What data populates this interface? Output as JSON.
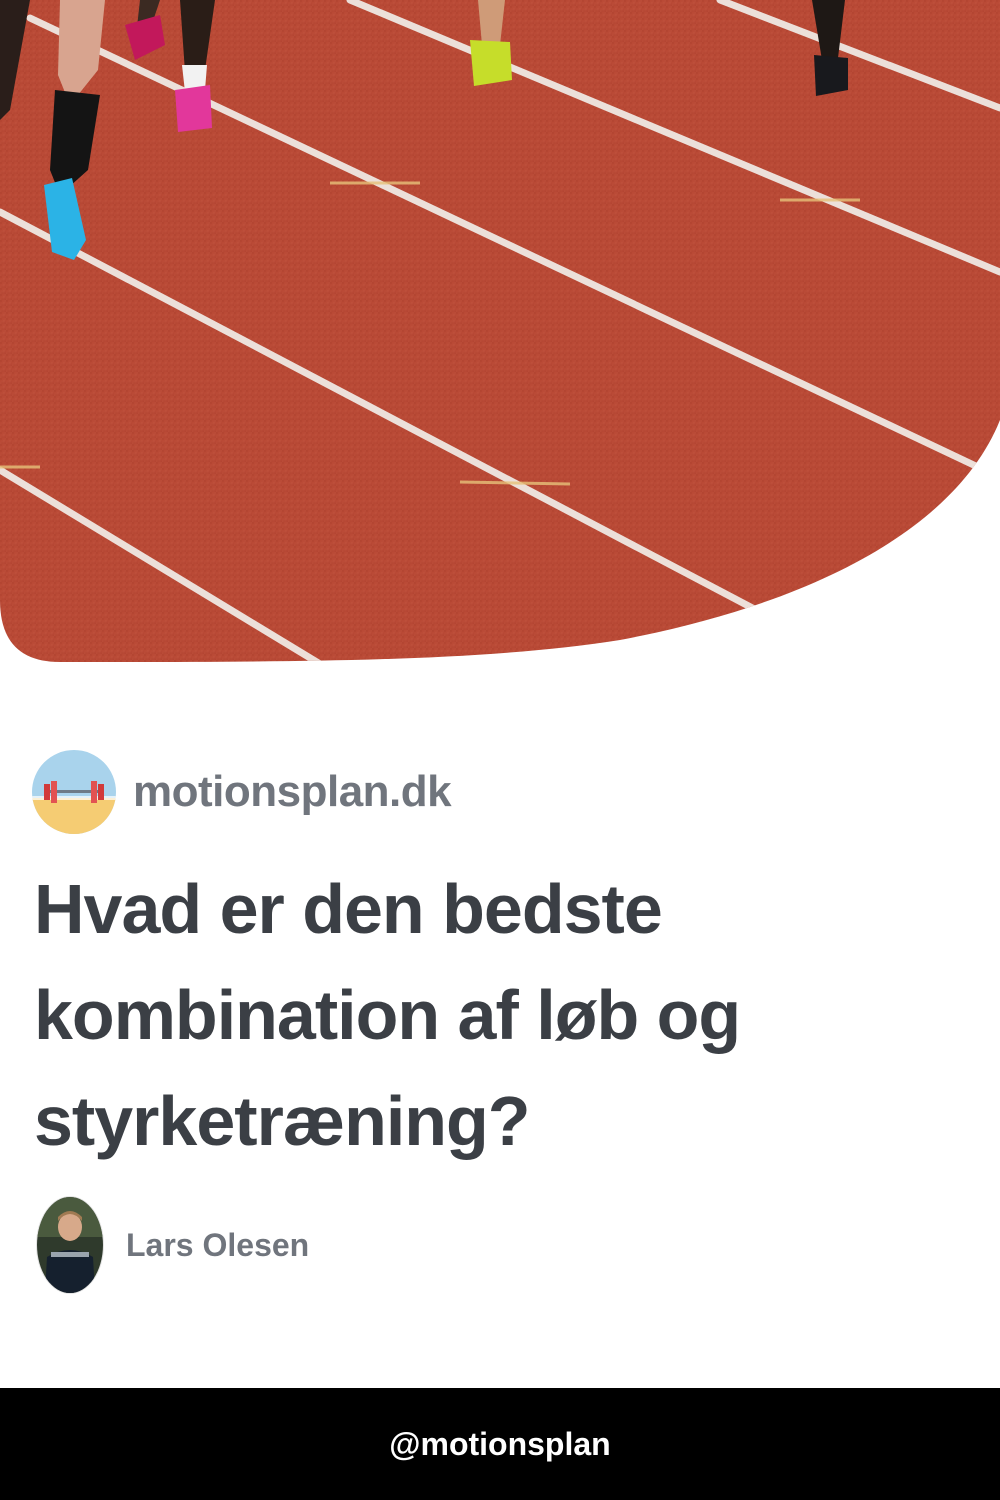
{
  "hero": {
    "image": "running-track-athletes-photo"
  },
  "site": {
    "logo_icon": "barbell-beach-logo-icon",
    "name": "motionsplan.dk"
  },
  "article": {
    "title_lines": [
      "Hvad er den bedste",
      "kombination af løb og",
      "styrketræning?"
    ]
  },
  "author": {
    "avatar_icon": "author-photo-avatar",
    "name": "Lars Olesen"
  },
  "footer": {
    "handle": "@motionsplan"
  },
  "colors": {
    "track": "#b84a36",
    "lane_lines": "#f1ede8",
    "brand_text": "#70757d",
    "title_text": "#3b3f45",
    "footer_bg": "#000000",
    "footer_text": "#ffffff"
  }
}
